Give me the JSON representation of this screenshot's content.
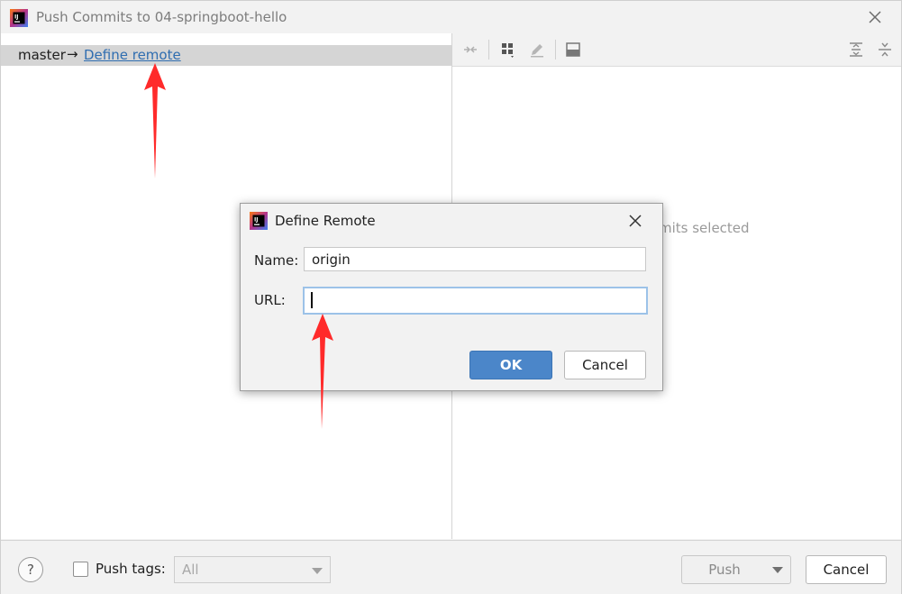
{
  "window": {
    "title": "Push Commits to 04-springboot-hello"
  },
  "branch_row": {
    "branch": "master",
    "arrow": "→",
    "link_label": "Define remote"
  },
  "details_pane": {
    "empty_text": "mits selected"
  },
  "bottom_bar": {
    "help_label": "?",
    "push_tags_label": "Push tags:",
    "tags_select_value": "All",
    "push_label": "Push",
    "cancel_label": "Cancel"
  },
  "dialog": {
    "title": "Define Remote",
    "name_label": "Name:",
    "name_value": "origin",
    "url_label": "URL:",
    "url_value": "",
    "ok_label": "OK",
    "cancel_label": "Cancel"
  },
  "colors": {
    "accent": "#4b86c9",
    "link": "#2f6db0",
    "annotation_arrow": "#ff2a2a"
  },
  "icons": [
    "intellij-logo-icon",
    "close-icon",
    "compare-icon",
    "group-icon",
    "edit-icon",
    "preview-icon",
    "expand-all-icon",
    "collapse-all-icon",
    "help-icon",
    "dropdown-caret-icon",
    "annotation-arrow-icon"
  ]
}
